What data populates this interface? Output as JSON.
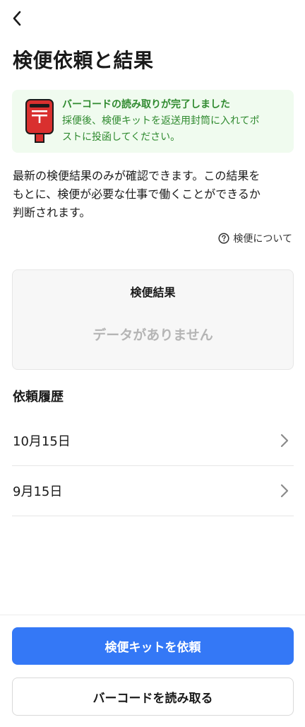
{
  "header": {
    "back_icon": "chevron-left-icon",
    "title": "検便依頼と結果"
  },
  "notice": {
    "icon": "postbox-icon",
    "title": "バーコードの読み取りが完了しました",
    "body_line1": "採便後、検便キットを返送用封筒に入れてポ",
    "body_line2": "ストに投函してください。"
  },
  "description": {
    "line1": "最新の検便結果のみが確認できます。この結果を",
    "line2": "もとに、検便が必要な仕事で働くことができるか",
    "line3": "判断されます。"
  },
  "about_link": {
    "icon": "question-circle-icon",
    "label": "検便について"
  },
  "result": {
    "title": "検便結果",
    "empty_text": "データがありません"
  },
  "history": {
    "title": "依頼履歴",
    "items": [
      {
        "date": "10月15日"
      },
      {
        "date": "9月15日"
      }
    ]
  },
  "actions": {
    "request_kit_label": "検便キットを依頼",
    "scan_barcode_label": "バーコードを読み取る"
  },
  "colors": {
    "primary": "#3478f6",
    "notice_bg": "#f0fbef",
    "notice_text": "#2f8a2f",
    "postbox_red": "#d9302f"
  }
}
